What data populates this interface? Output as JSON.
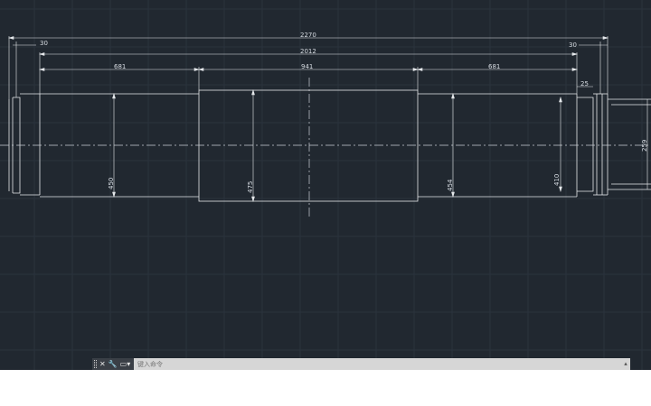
{
  "drawing": {
    "dimensions": {
      "overall_length": "2270",
      "inner_length": "2012",
      "left_end_offset": "30",
      "right_end_offset": "30",
      "left_section_length": "681",
      "middle_section_length": "941",
      "right_section_length": "681",
      "right_step": "25",
      "left_section_diameter": "450",
      "middle_section_diameter": "475",
      "right_section_diameter": "454",
      "journal_diameter": "410",
      "shaft_end_diameter": "259"
    }
  },
  "command_line": {
    "placeholder": "键入命令",
    "tools": {
      "close_icon": "close-icon",
      "customize_icon": "wrench-icon",
      "recent_icon": "command-history-icon"
    }
  },
  "colors": {
    "background": "#212830",
    "grid": "#2b333d",
    "geometry": "#e6e9ec",
    "command_bar": "#d6d6d6"
  }
}
